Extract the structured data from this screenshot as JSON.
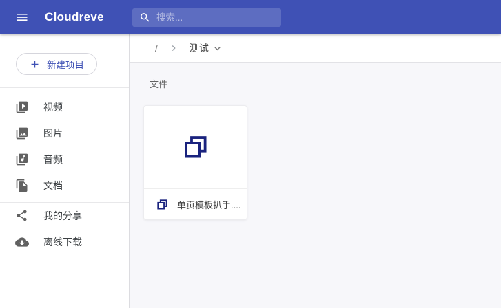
{
  "app_bar": {
    "title": "Cloudreve",
    "search_placeholder": "搜索..."
  },
  "sidebar": {
    "new_button_label": "新建项目",
    "items": [
      {
        "label": "视频",
        "icon": "video-library-icon"
      },
      {
        "label": "图片",
        "icon": "photo-library-icon"
      },
      {
        "label": "音频",
        "icon": "music-library-icon"
      },
      {
        "label": "文档",
        "icon": "documents-icon"
      },
      {
        "label": "我的分享",
        "icon": "share-icon"
      },
      {
        "label": "离线下载",
        "icon": "cloud-download-icon"
      }
    ]
  },
  "breadcrumb": {
    "root": "/",
    "current": "测试"
  },
  "content": {
    "section_label": "文件",
    "files": [
      {
        "name": "单页模板扒手....",
        "icon": "copy-file-icon"
      }
    ]
  },
  "colors": {
    "app_bar": "#3f51b5",
    "accent": "#3f51b5",
    "file_icon": "#1a237e",
    "content_background": "#f7f7fa"
  }
}
